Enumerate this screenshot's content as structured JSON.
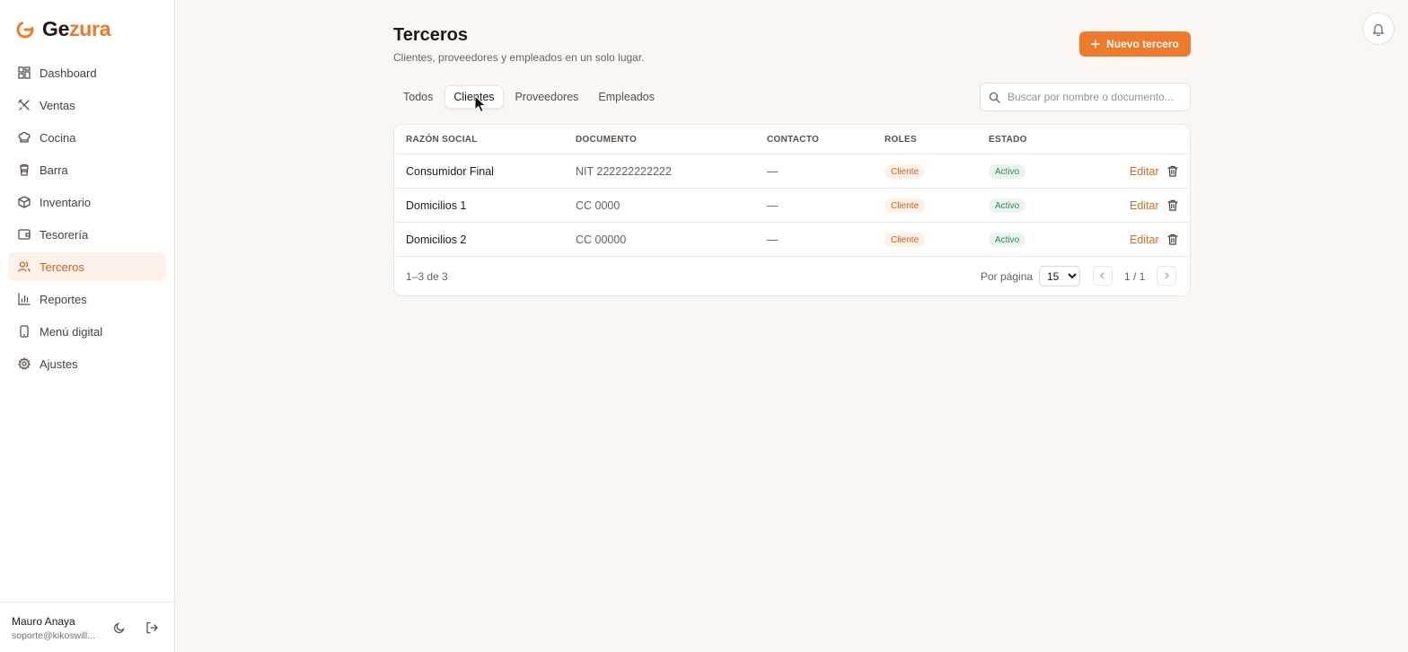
{
  "brand": {
    "part1": "Ge",
    "part2": "zura"
  },
  "sidebar": {
    "items": [
      {
        "label": "Dashboard",
        "icon": "dashboard-icon",
        "active": false
      },
      {
        "label": "Ventas",
        "icon": "utensils-icon",
        "active": false
      },
      {
        "label": "Cocina",
        "icon": "chef-hat-icon",
        "active": false
      },
      {
        "label": "Barra",
        "icon": "cup-icon",
        "active": false
      },
      {
        "label": "Inventario",
        "icon": "package-icon",
        "active": false
      },
      {
        "label": "Tesorería",
        "icon": "wallet-icon",
        "active": false
      },
      {
        "label": "Terceros",
        "icon": "users-icon",
        "active": true
      },
      {
        "label": "Reportes",
        "icon": "bar-chart-icon",
        "active": false
      },
      {
        "label": "Menú digital",
        "icon": "smartphone-icon",
        "active": false
      },
      {
        "label": "Ajustes",
        "icon": "gear-icon",
        "active": false
      }
    ]
  },
  "user": {
    "name": "Mauro Anaya",
    "email": "soporte@kikoswill..."
  },
  "header": {
    "title": "Terceros",
    "subtitle": "Clientes, proveedores y empleados en un solo lugar.",
    "new_button": "Nuevo tercero"
  },
  "tabs": [
    {
      "label": "Todos",
      "active": false
    },
    {
      "label": "Clientes",
      "active": true
    },
    {
      "label": "Proveedores",
      "active": false
    },
    {
      "label": "Empleados",
      "active": false
    }
  ],
  "search": {
    "placeholder": "Buscar por nombre o documento...",
    "value": ""
  },
  "table": {
    "headers": [
      "RAZÓN SOCIAL",
      "DOCUMENTO",
      "CONTACTO",
      "ROLES",
      "ESTADO"
    ],
    "rows": [
      {
        "name": "Consumidor Final",
        "document": "NIT 222222222222",
        "contact": "—",
        "role": "Cliente",
        "status": "Activo",
        "edit": "Editar"
      },
      {
        "name": "Domicilios 1",
        "document": "CC 0000",
        "contact": "—",
        "role": "Cliente",
        "status": "Activo",
        "edit": "Editar"
      },
      {
        "name": "Domicilios 2",
        "document": "CC 00000",
        "contact": "—",
        "role": "Cliente",
        "status": "Activo",
        "edit": "Editar"
      }
    ]
  },
  "pagination": {
    "range": "1–3 de 3",
    "per_page_label": "Por página",
    "per_page_value": "15",
    "page": "1 / 1"
  },
  "colors": {
    "accent": "#ef7a2c",
    "active_bg": "#fdf1e9",
    "status_green": "#2f8a4f"
  }
}
